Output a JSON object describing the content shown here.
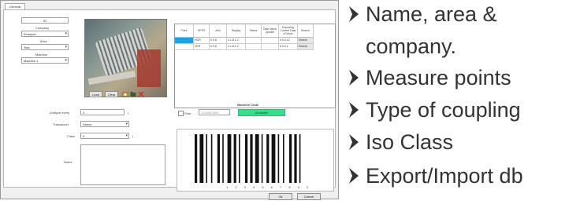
{
  "window": {
    "tab_label": "General",
    "left": {
      "id_value": "ID",
      "company_label": "Company",
      "company_value": "Example",
      "area_label": "Area",
      "area_value": "Test",
      "machine_label": "Machine",
      "machine_value": "Machine 1"
    },
    "photo_buttons": [
      "Load",
      "Clear"
    ],
    "form": {
      "analyze_label": "Analyze every",
      "analyze_value": "3",
      "transducer_label": "Transducer",
      "transducer_value": "Select",
      "class_label": "Class",
      "class_value": "II",
      "notes_label": "Notes"
    },
    "table": {
      "headers": [
        "Point",
        "HPFS",
        "Axis",
        "Display",
        "Status",
        "Date Value Update",
        "Exporting Current Date of Work",
        "Search"
      ],
      "rows": [
        [
          "",
          "HOR",
          "0.0.8",
          "1.1.8.1.2",
          "",
          "",
          "9.0.0.12",
          "Search"
        ],
        [
          "",
          "VER",
          "0.0.8",
          "1.1.8.1.2",
          "",
          "",
          "9.0.0.1",
          "Search"
        ]
      ],
      "highlight_color": "#1aa3e8"
    },
    "machine_code": {
      "title": "Machine Code",
      "print_label": "Print",
      "code_field_value": "1234567890",
      "status_label": "Available",
      "status_color": "#33e08a"
    },
    "barcode_digits": "1 2 3 4 5 6 7 8 9 0",
    "ok_button": "Ok",
    "cancel_button": "Cancel"
  },
  "bullets": [
    {
      "icon": "chevron-right-icon",
      "text": "Name, area &"
    },
    {
      "icon": "",
      "text": "company."
    },
    {
      "icon": "chevron-right-icon",
      "text": "Measure points"
    },
    {
      "icon": "chevron-right-icon",
      "text": "Type of coupling"
    },
    {
      "icon": "chevron-right-icon",
      "text": "Iso Class"
    },
    {
      "icon": "chevron-right-icon",
      "text": "Export/Import db"
    }
  ]
}
